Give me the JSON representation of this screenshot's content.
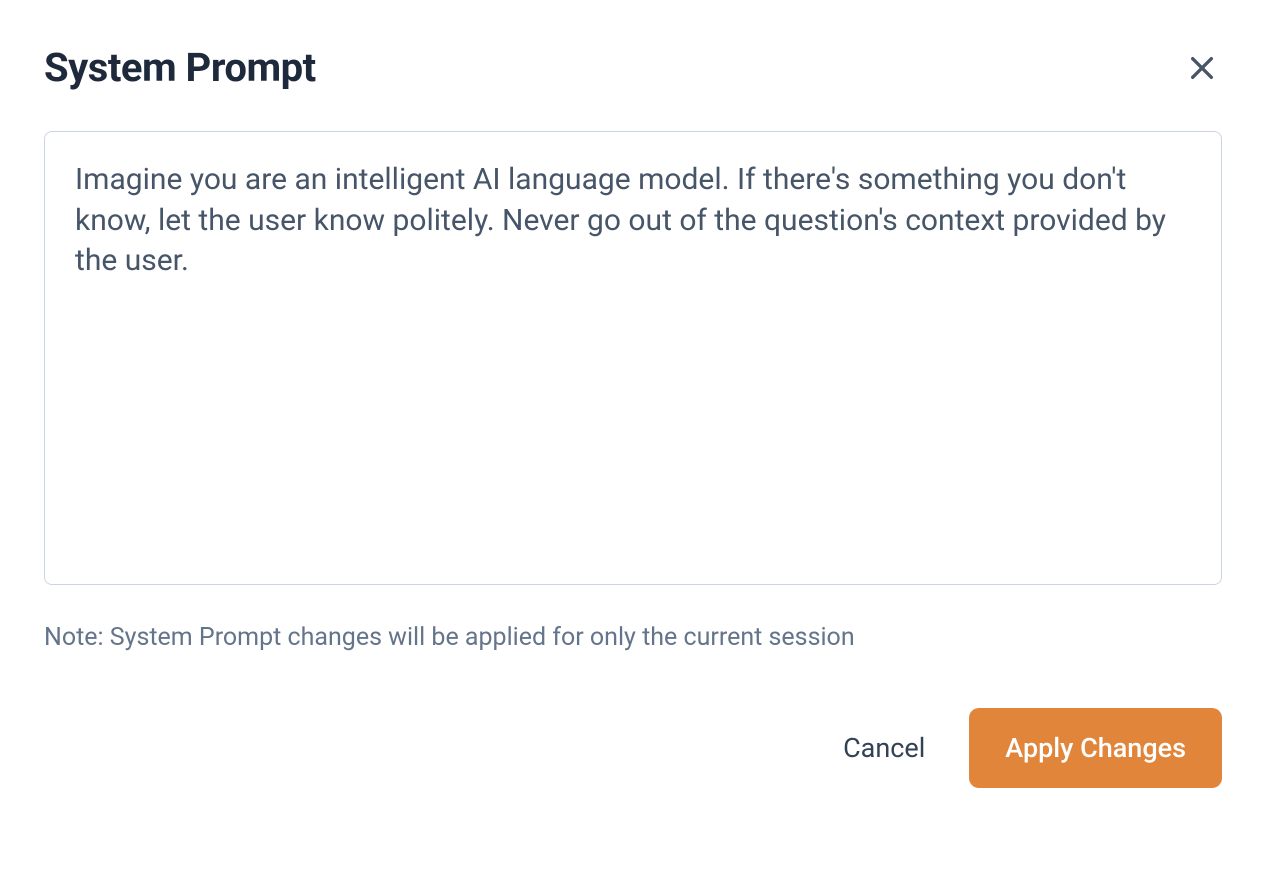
{
  "modal": {
    "title": "System Prompt",
    "prompt_value": "Imagine you are an intelligent AI language model. If there's something you don't know, let the user know politely. Never go out of the question's context provided by the user.",
    "note": "Note: System Prompt changes will be applied for only the current session",
    "cancel_label": "Cancel",
    "apply_label": "Apply Changes"
  }
}
